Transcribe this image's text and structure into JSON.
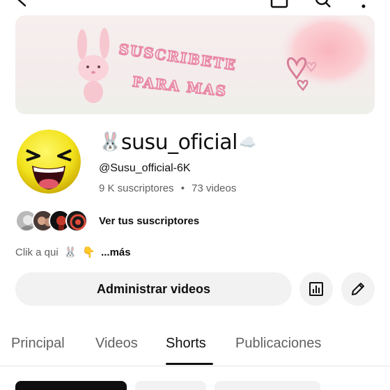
{
  "banner": {
    "line1": "SUSCRIBETE",
    "line2": "PARA MAS"
  },
  "channel": {
    "name": "susu_oficial",
    "name_prefix_emoji": "🐰",
    "name_suffix_emoji": "☁️",
    "handle": "@Susu_official-6K",
    "subscribers": "9 K suscriptores",
    "separator": "•",
    "videos": "73 videos"
  },
  "subscribers_preview": {
    "link_label": "Ver tus suscriptores"
  },
  "description": {
    "text": "Clik a qui",
    "emoji1": "🐰",
    "emoji2": "👇",
    "more": "...más"
  },
  "actions": {
    "manage_label": "Administrar videos",
    "analytics_icon": "analytics-icon",
    "edit_icon": "pencil-icon"
  },
  "tabs": [
    {
      "label": "Principal",
      "active": false
    },
    {
      "label": "Videos",
      "active": false
    },
    {
      "label": "Shorts",
      "active": true
    },
    {
      "label": "Publicaciones",
      "active": false
    }
  ],
  "colors": {
    "accent_text": "#0f0f0f",
    "muted_text": "#606060",
    "button_bg": "#f2f2f2",
    "banner_pink": "#f2a7c0"
  }
}
